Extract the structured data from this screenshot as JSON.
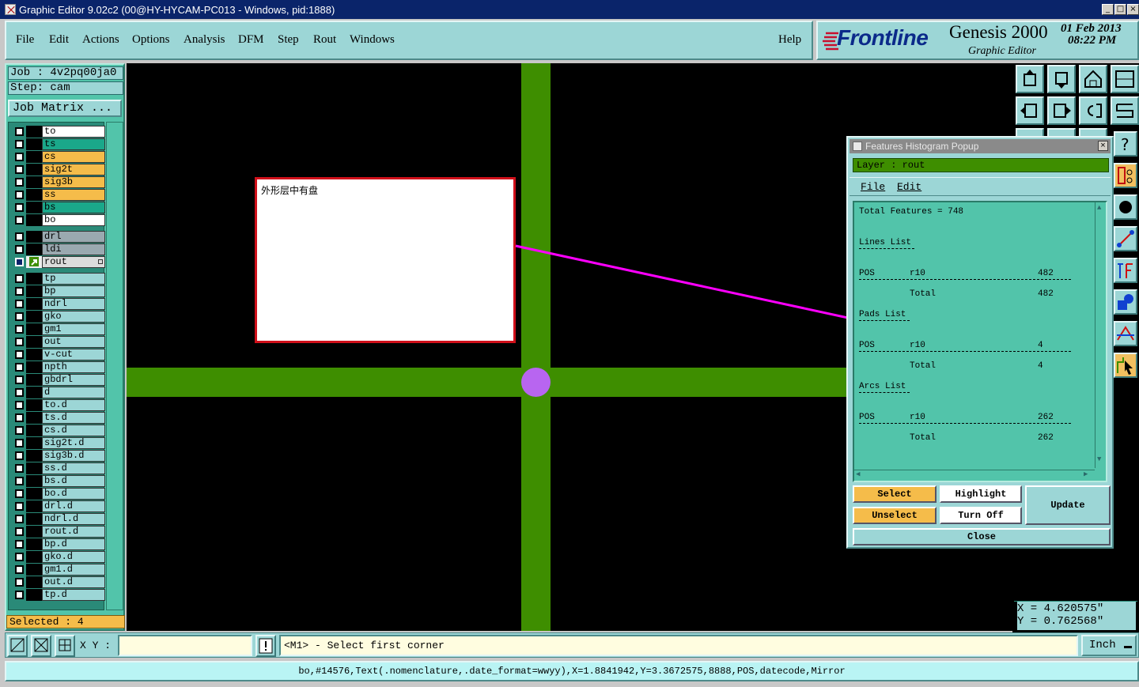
{
  "window": {
    "title": "Graphic Editor 9.02c2 (00@HY-HYCAM-PC013 - Windows, pid:1888)"
  },
  "menu": {
    "items": [
      "File",
      "Edit",
      "Actions",
      "Options",
      "Analysis",
      "DFM",
      "Step",
      "Rout",
      "Windows"
    ],
    "help": "Help"
  },
  "logo": {
    "brand": "Frontline",
    "product": "Genesis 2000",
    "subtitle": "Graphic Editor",
    "date": "01 Feb 2013",
    "time": "08:22 PM"
  },
  "job": {
    "job_label": "Job : 4v2pq00ja0",
    "step_label": "Step: cam",
    "matrix_button": "Job Matrix ..."
  },
  "layers": {
    "group1": [
      {
        "name": "to",
        "color": "#ffffff"
      },
      {
        "name": "ts",
        "color": "#1aa88a"
      },
      {
        "name": "cs",
        "color": "#f5bc4a"
      },
      {
        "name": "sig2t",
        "color": "#f5bc4a"
      },
      {
        "name": "sig3b",
        "color": "#f5bc4a"
      },
      {
        "name": "ss",
        "color": "#f5bc4a"
      },
      {
        "name": "bs",
        "color": "#1aa88a"
      },
      {
        "name": "bo",
        "color": "#ffffff"
      }
    ],
    "group2": [
      {
        "name": "drl",
        "color": "#9aa9b0"
      },
      {
        "name": "ldi",
        "color": "#9aa9b0"
      },
      {
        "name": "rout",
        "color": "#dcdcdc"
      }
    ],
    "group3": [
      "tp",
      "bp",
      "ndrl",
      "gko",
      "gm1",
      "out",
      "v-cut",
      "npth",
      "gbdrl",
      "d",
      "to.d",
      "ts.d",
      "cs.d",
      "sig2t.d",
      "sig3b.d",
      "ss.d",
      "bs.d",
      "bo.d",
      "drl.d",
      "ndrl.d",
      "rout.d",
      "bp.d",
      "gko.d",
      "gm1.d",
      "out.d",
      "tp.d"
    ],
    "group3_color": "#9cd6d6",
    "selected": "Selected : 4"
  },
  "canvas": {
    "annotation": "外形层中有盘",
    "trace_color": "#3e8e00",
    "pad_color": "#b865f0",
    "arrow_color": "#ff00ff"
  },
  "popup": {
    "title": "Features Histogram Popup",
    "layer": "Layer :  rout",
    "menu": [
      "File",
      "Edit"
    ],
    "total": "Total Features = 748",
    "sections": [
      {
        "title": "Lines List",
        "pos": "POS",
        "sym": "r10",
        "count": "482",
        "total_label": "Total",
        "total": "482"
      },
      {
        "title": "Pads List",
        "pos": "POS",
        "sym": "r10",
        "count": "4",
        "total_label": "Total",
        "total": "4"
      },
      {
        "title": "Arcs List",
        "pos": "POS",
        "sym": "r10",
        "count": "262",
        "total_label": "Total",
        "total": "262"
      }
    ],
    "buttons": {
      "select": "Select",
      "highlight": "Highlight",
      "update": "Update",
      "unselect": "Unselect",
      "turn_off": "Turn Off",
      "close": "Close"
    }
  },
  "coords": {
    "x": "X  =  4.620575\"",
    "y": "Y  =  0.762568\""
  },
  "bottom": {
    "xy_label": "X Y :",
    "xy_value": "",
    "prompt": "<M1> - Select first corner",
    "units": "Inch"
  },
  "status": {
    "text": "bo,#14576,Text(.nomenclature,.date_format=wwyy),X=1.8841942,Y=3.3672575,8888,POS,datecode,Mirror"
  }
}
